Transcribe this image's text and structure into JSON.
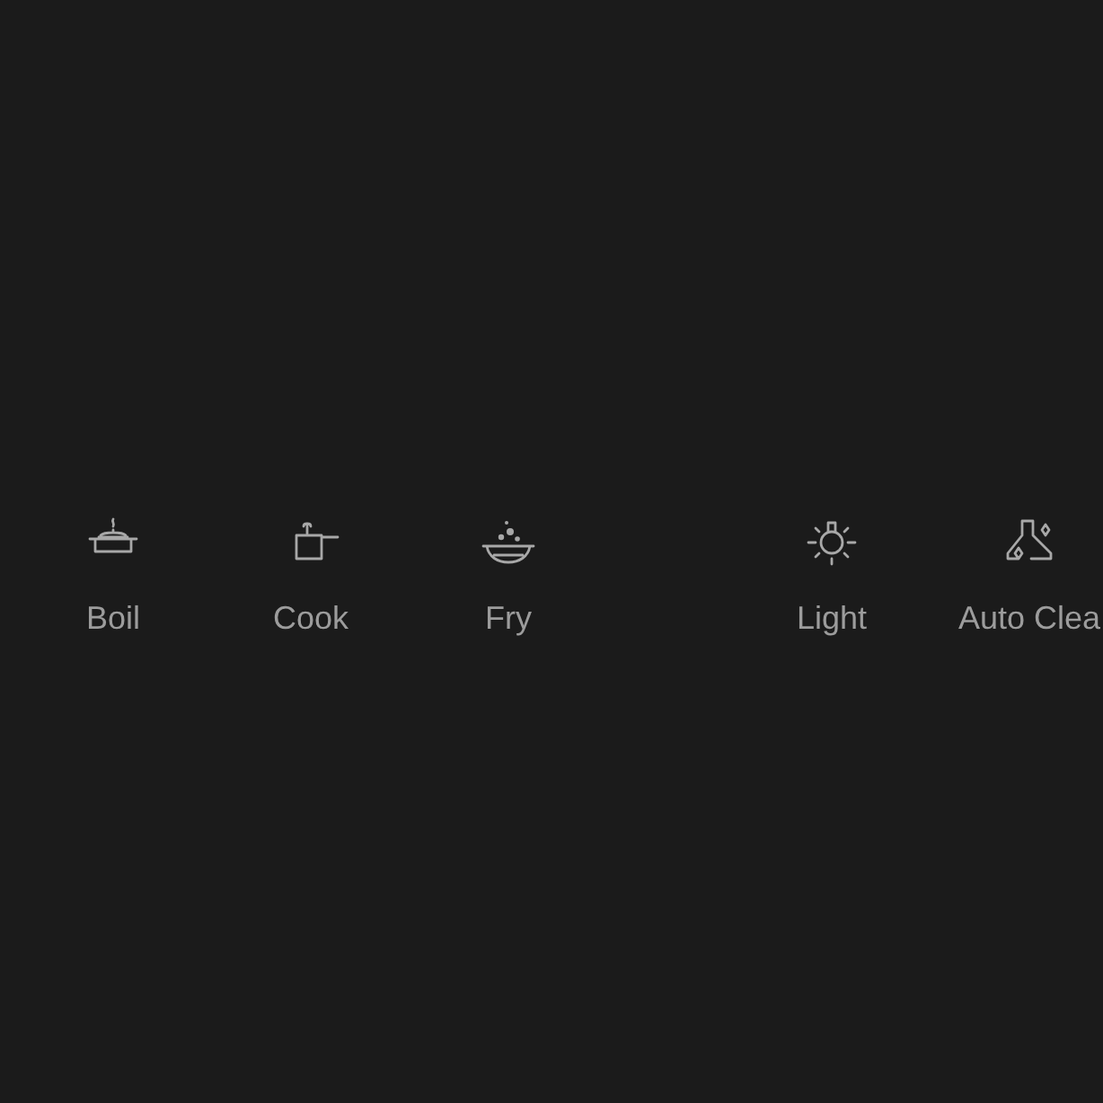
{
  "groups": [
    {
      "buttons": [
        {
          "kind": "boil",
          "label": "Boil"
        },
        {
          "kind": "cook",
          "label": "Cook"
        },
        {
          "kind": "fry",
          "label": "Fry"
        }
      ]
    },
    {
      "buttons": [
        {
          "kind": "light",
          "label": "Light"
        },
        {
          "kind": "clean",
          "label": "Auto Clea"
        }
      ]
    }
  ]
}
